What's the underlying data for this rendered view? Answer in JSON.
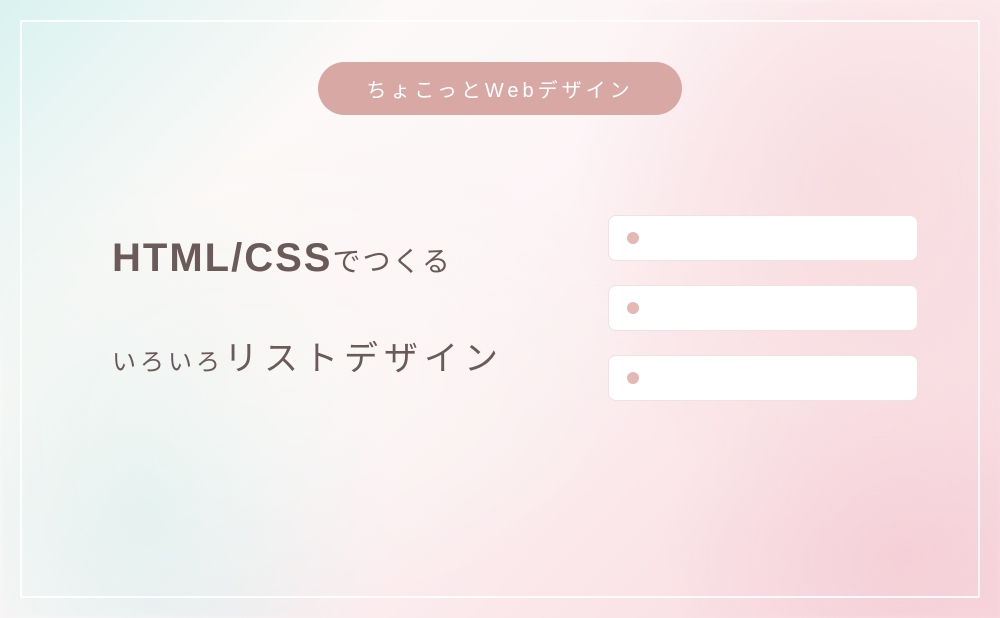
{
  "badge": {
    "text": "ちょこっとWebデザイン"
  },
  "title": {
    "line1_bold": "HTML/CSS",
    "line1_small": "でつくる",
    "line2_small": "いろいろ",
    "line2_big": "リストデザイン"
  },
  "colors": {
    "badge_bg": "#d8a8a5",
    "bullet": "#e6b8b5",
    "text": "#6b5a5a"
  },
  "list_items_count": 3
}
